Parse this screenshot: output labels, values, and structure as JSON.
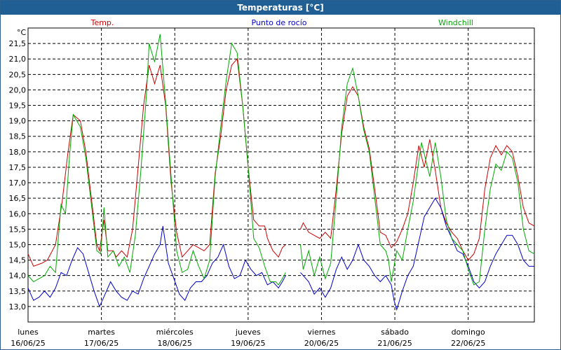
{
  "chart_data": {
    "type": "line",
    "title": "Temperaturas [°C]",
    "yunit": "°C",
    "ylim": [
      12.5,
      22.0
    ],
    "y_ticks": [
      "13,0",
      "13,5",
      "14,0",
      "14,5",
      "15,0",
      "15,5",
      "16,0",
      "16,5",
      "17,0",
      "17,5",
      "18,0",
      "18,5",
      "19,0",
      "19,5",
      "20,0",
      "20,5",
      "21,0",
      "21,5"
    ],
    "x_days": [
      {
        "day": "lunes",
        "date": "16/06/25"
      },
      {
        "day": "martes",
        "date": "17/06/25"
      },
      {
        "day": "miércoles",
        "date": "18/06/25"
      },
      {
        "day": "jueves",
        "date": "19/06/25"
      },
      {
        "day": "viernes",
        "date": "20/06/25"
      },
      {
        "day": "sábado",
        "date": "21/06/25"
      },
      {
        "day": "domingo",
        "date": "22/06/25"
      }
    ],
    "x_range_days": [
      0,
      7
    ],
    "grid": true,
    "series": [
      {
        "name": "Temp.",
        "color": "#cc0000",
        "points": [
          [
            0.0,
            14.7
          ],
          [
            0.1,
            14.3
          ],
          [
            0.25,
            14.4
          ],
          [
            0.35,
            14.5
          ],
          [
            0.5,
            15.0
          ],
          [
            0.62,
            16.4
          ],
          [
            0.72,
            17.9
          ],
          [
            0.82,
            19.2
          ],
          [
            0.95,
            19.0
          ],
          [
            1.05,
            18.0
          ],
          [
            1.15,
            16.5
          ],
          [
            1.25,
            15.0
          ],
          [
            1.3,
            14.8
          ],
          [
            1.38,
            15.8
          ],
          [
            1.45,
            14.8
          ],
          [
            1.55,
            14.8
          ],
          [
            1.6,
            14.6
          ],
          [
            1.7,
            14.8
          ],
          [
            1.8,
            14.6
          ],
          [
            1.9,
            15.5
          ],
          [
            2.0,
            17.5
          ],
          [
            2.1,
            19.5
          ],
          [
            2.2,
            20.8
          ],
          [
            2.3,
            20.2
          ],
          [
            2.4,
            20.8
          ],
          [
            2.5,
            19.5
          ],
          [
            2.6,
            17.0
          ],
          [
            2.7,
            15.4
          ],
          [
            2.8,
            14.6
          ],
          [
            2.9,
            14.8
          ],
          [
            3.0,
            15.0
          ],
          [
            3.1,
            14.9
          ],
          [
            3.2,
            14.8
          ],
          [
            3.3,
            15.0
          ],
          [
            3.4,
            17.3
          ],
          [
            3.5,
            18.5
          ],
          [
            3.6,
            20.0
          ],
          [
            3.7,
            20.8
          ],
          [
            3.8,
            21.0
          ],
          [
            3.9,
            19.5
          ],
          [
            4.0,
            17.5
          ],
          [
            4.1,
            15.8
          ],
          [
            4.2,
            15.6
          ],
          [
            4.3,
            15.6
          ],
          [
            4.35,
            15.2
          ],
          [
            4.4,
            15.0
          ],
          [
            4.45,
            14.8
          ],
          [
            4.5,
            14.7
          ],
          [
            4.55,
            14.6
          ],
          [
            4.62,
            14.9
          ],
          [
            4.68,
            15.0
          ],
          [
            4.75,
            null
          ],
          [
            4.95,
            15.5
          ],
          [
            5.0,
            15.7
          ],
          [
            5.1,
            15.4
          ],
          [
            5.2,
            15.3
          ],
          [
            5.3,
            15.2
          ],
          [
            5.4,
            15.4
          ],
          [
            5.5,
            15.2
          ],
          [
            5.6,
            16.8
          ],
          [
            5.7,
            18.6
          ],
          [
            5.8,
            19.8
          ],
          [
            5.9,
            20.1
          ],
          [
            6.0,
            19.8
          ],
          [
            6.1,
            18.8
          ],
          [
            6.2,
            18.1
          ],
          [
            6.3,
            16.8
          ],
          [
            6.4,
            15.4
          ],
          [
            6.5,
            15.3
          ],
          [
            6.6,
            14.9
          ],
          [
            6.7,
            15.1
          ],
          [
            6.8,
            15.5
          ],
          [
            6.9,
            16.0
          ],
          [
            7.0,
            17.0
          ],
          [
            7.1,
            18.2
          ],
          [
            7.2,
            17.5
          ],
          [
            7.3,
            18.4
          ],
          [
            7.4,
            17.4
          ],
          [
            7.5,
            16.2
          ],
          [
            7.6,
            15.7
          ],
          [
            7.7,
            15.4
          ],
          [
            7.8,
            15.2
          ],
          [
            7.9,
            14.8
          ],
          [
            8.0,
            14.5
          ],
          [
            8.1,
            14.7
          ],
          [
            8.2,
            15.2
          ],
          [
            8.3,
            16.8
          ],
          [
            8.4,
            17.8
          ],
          [
            8.5,
            18.2
          ],
          [
            8.6,
            17.9
          ],
          [
            8.7,
            18.2
          ],
          [
            8.8,
            18.0
          ],
          [
            8.9,
            17.2
          ],
          [
            9.0,
            16.2
          ],
          [
            9.1,
            15.7
          ],
          [
            9.2,
            15.6
          ]
        ]
      },
      {
        "name": "Punto de rocío",
        "color": "#0000cc",
        "points": [
          [
            0.0,
            13.6
          ],
          [
            0.1,
            13.2
          ],
          [
            0.2,
            13.3
          ],
          [
            0.3,
            13.5
          ],
          [
            0.4,
            13.3
          ],
          [
            0.5,
            13.6
          ],
          [
            0.6,
            14.1
          ],
          [
            0.7,
            14.0
          ],
          [
            0.8,
            14.5
          ],
          [
            0.9,
            14.9
          ],
          [
            1.0,
            14.7
          ],
          [
            1.1,
            14.1
          ],
          [
            1.2,
            13.5
          ],
          [
            1.3,
            13.0
          ],
          [
            1.4,
            13.4
          ],
          [
            1.5,
            13.8
          ],
          [
            1.6,
            13.5
          ],
          [
            1.7,
            13.3
          ],
          [
            1.8,
            13.2
          ],
          [
            1.9,
            13.5
          ],
          [
            2.0,
            13.4
          ],
          [
            2.1,
            13.9
          ],
          [
            2.2,
            14.3
          ],
          [
            2.3,
            14.7
          ],
          [
            2.4,
            15.0
          ],
          [
            2.45,
            15.6
          ],
          [
            2.55,
            14.4
          ],
          [
            2.65,
            13.9
          ],
          [
            2.75,
            13.4
          ],
          [
            2.85,
            13.2
          ],
          [
            2.95,
            13.6
          ],
          [
            3.05,
            13.8
          ],
          [
            3.15,
            13.8
          ],
          [
            3.25,
            14.0
          ],
          [
            3.35,
            14.4
          ],
          [
            3.45,
            14.6
          ],
          [
            3.55,
            15.0
          ],
          [
            3.65,
            14.3
          ],
          [
            3.75,
            13.9
          ],
          [
            3.85,
            14.0
          ],
          [
            3.95,
            14.5
          ],
          [
            4.05,
            14.2
          ],
          [
            4.15,
            14.0
          ],
          [
            4.25,
            14.1
          ],
          [
            4.35,
            13.7
          ],
          [
            4.45,
            13.8
          ],
          [
            4.55,
            13.6
          ],
          [
            4.62,
            13.8
          ],
          [
            4.68,
            14.0
          ],
          [
            4.75,
            null
          ],
          [
            4.95,
            14.1
          ],
          [
            5.0,
            14.0
          ],
          [
            5.1,
            13.8
          ],
          [
            5.2,
            13.4
          ],
          [
            5.3,
            13.6
          ],
          [
            5.4,
            13.3
          ],
          [
            5.5,
            13.6
          ],
          [
            5.6,
            14.2
          ],
          [
            5.7,
            14.6
          ],
          [
            5.8,
            14.2
          ],
          [
            5.9,
            14.5
          ],
          [
            6.0,
            15.0
          ],
          [
            6.1,
            14.5
          ],
          [
            6.2,
            14.3
          ],
          [
            6.3,
            14.0
          ],
          [
            6.4,
            13.8
          ],
          [
            6.5,
            14.0
          ],
          [
            6.6,
            13.7
          ],
          [
            6.65,
            13.2
          ],
          [
            6.7,
            12.9
          ],
          [
            6.8,
            13.5
          ],
          [
            6.9,
            14.0
          ],
          [
            7.0,
            14.3
          ],
          [
            7.1,
            15.1
          ],
          [
            7.2,
            15.9
          ],
          [
            7.3,
            16.2
          ],
          [
            7.4,
            16.5
          ],
          [
            7.5,
            16.2
          ],
          [
            7.6,
            15.6
          ],
          [
            7.7,
            15.2
          ],
          [
            7.8,
            14.8
          ],
          [
            7.9,
            14.7
          ],
          [
            8.0,
            14.3
          ],
          [
            8.1,
            13.8
          ],
          [
            8.2,
            13.6
          ],
          [
            8.3,
            13.8
          ],
          [
            8.4,
            14.3
          ],
          [
            8.5,
            14.7
          ],
          [
            8.6,
            15.0
          ],
          [
            8.7,
            15.3
          ],
          [
            8.8,
            15.3
          ],
          [
            8.9,
            15.0
          ],
          [
            9.0,
            14.5
          ],
          [
            9.1,
            14.3
          ],
          [
            9.2,
            14.3
          ]
        ]
      },
      {
        "name": "Windchill",
        "color": "#00aa00",
        "points": [
          [
            0.0,
            14.0
          ],
          [
            0.1,
            13.8
          ],
          [
            0.2,
            13.9
          ],
          [
            0.3,
            14.0
          ],
          [
            0.4,
            14.3
          ],
          [
            0.5,
            14.1
          ],
          [
            0.6,
            16.3
          ],
          [
            0.68,
            16.0
          ],
          [
            0.75,
            17.8
          ],
          [
            0.82,
            19.2
          ],
          [
            0.95,
            18.8
          ],
          [
            1.05,
            17.8
          ],
          [
            1.15,
            16.3
          ],
          [
            1.25,
            14.8
          ],
          [
            1.32,
            14.7
          ],
          [
            1.38,
            16.2
          ],
          [
            1.45,
            14.6
          ],
          [
            1.55,
            14.8
          ],
          [
            1.65,
            14.3
          ],
          [
            1.75,
            14.6
          ],
          [
            1.85,
            14.1
          ],
          [
            1.95,
            15.3
          ],
          [
            2.05,
            17.4
          ],
          [
            2.15,
            19.8
          ],
          [
            2.2,
            21.5
          ],
          [
            2.3,
            20.9
          ],
          [
            2.4,
            21.8
          ],
          [
            2.5,
            19.6
          ],
          [
            2.6,
            17.2
          ],
          [
            2.7,
            14.8
          ],
          [
            2.8,
            14.1
          ],
          [
            2.9,
            14.2
          ],
          [
            3.0,
            14.8
          ],
          [
            3.1,
            14.3
          ],
          [
            3.2,
            13.9
          ],
          [
            3.3,
            14.5
          ],
          [
            3.4,
            17.2
          ],
          [
            3.5,
            18.8
          ],
          [
            3.6,
            20.3
          ],
          [
            3.7,
            21.5
          ],
          [
            3.8,
            21.2
          ],
          [
            3.9,
            19.5
          ],
          [
            4.0,
            17.5
          ],
          [
            4.1,
            15.2
          ],
          [
            4.2,
            14.9
          ],
          [
            4.3,
            14.3
          ],
          [
            4.4,
            13.8
          ],
          [
            4.5,
            13.8
          ],
          [
            4.55,
            13.7
          ],
          [
            4.62,
            13.9
          ],
          [
            4.68,
            14.1
          ],
          [
            4.75,
            null
          ],
          [
            4.95,
            15.0
          ],
          [
            5.0,
            14.2
          ],
          [
            5.1,
            14.8
          ],
          [
            5.2,
            14.0
          ],
          [
            5.3,
            14.6
          ],
          [
            5.4,
            13.9
          ],
          [
            5.5,
            14.4
          ],
          [
            5.6,
            16.5
          ],
          [
            5.7,
            18.8
          ],
          [
            5.8,
            20.2
          ],
          [
            5.9,
            20.7
          ],
          [
            6.0,
            19.8
          ],
          [
            6.1,
            18.7
          ],
          [
            6.2,
            18.0
          ],
          [
            6.3,
            16.5
          ],
          [
            6.4,
            15.0
          ],
          [
            6.5,
            14.8
          ],
          [
            6.55,
            14.5
          ],
          [
            6.6,
            13.8
          ],
          [
            6.7,
            14.8
          ],
          [
            6.8,
            14.5
          ],
          [
            6.9,
            15.5
          ],
          [
            7.0,
            16.4
          ],
          [
            7.1,
            17.7
          ],
          [
            7.15,
            18.3
          ],
          [
            7.3,
            17.2
          ],
          [
            7.4,
            18.3
          ],
          [
            7.5,
            17.2
          ],
          [
            7.6,
            15.8
          ],
          [
            7.7,
            15.2
          ],
          [
            7.8,
            15.0
          ],
          [
            7.9,
            14.8
          ],
          [
            8.0,
            14.2
          ],
          [
            8.1,
            13.7
          ],
          [
            8.2,
            13.8
          ],
          [
            8.3,
            15.5
          ],
          [
            8.4,
            16.8
          ],
          [
            8.5,
            17.6
          ],
          [
            8.6,
            17.4
          ],
          [
            8.7,
            18.0
          ],
          [
            8.8,
            17.8
          ],
          [
            8.9,
            17.0
          ],
          [
            9.0,
            15.5
          ],
          [
            9.1,
            14.8
          ],
          [
            9.2,
            14.7
          ]
        ]
      }
    ]
  }
}
